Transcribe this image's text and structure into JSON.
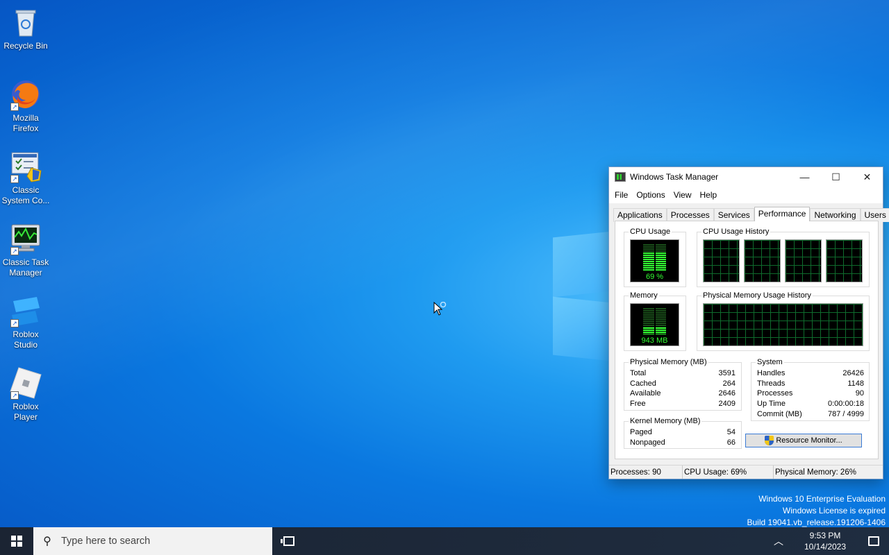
{
  "desktop": {
    "icons": [
      {
        "label": "Recycle Bin",
        "icon": "recycle-bin-icon"
      },
      {
        "label": "Mozilla Firefox",
        "icon": "firefox-icon"
      },
      {
        "label": "Classic System Co...",
        "icon": "classic-system-config-icon"
      },
      {
        "label": "Classic Task Manager",
        "icon": "task-manager-icon"
      },
      {
        "label": "Roblox Studio",
        "icon": "roblox-studio-icon"
      },
      {
        "label": "Roblox Player",
        "icon": "roblox-player-icon"
      }
    ],
    "watermark": {
      "line1": "Windows 10 Enterprise Evaluation",
      "line2": "Windows License is expired",
      "line3": "Build 19041.vb_release.191206-1406"
    }
  },
  "task_manager": {
    "title": "Windows Task Manager",
    "caption_buttons": {
      "minimize": "—",
      "maximize": "☐",
      "close": "✕"
    },
    "menu": [
      "File",
      "Options",
      "View",
      "Help"
    ],
    "tabs": [
      "Applications",
      "Processes",
      "Services",
      "Performance",
      "Networking",
      "Users"
    ],
    "active_tab": "Performance",
    "cpu_usage": {
      "label": "CPU Usage",
      "value": "69 %",
      "percent": 69
    },
    "cpu_history": {
      "label": "CPU Usage History",
      "cores": 4
    },
    "memory": {
      "label": "Memory",
      "value": "943 MB",
      "percent": 26
    },
    "memory_history": {
      "label": "Physical Memory Usage History"
    },
    "physical_memory": {
      "label": "Physical Memory (MB)",
      "rows": [
        {
          "name": "Total",
          "value": "3591"
        },
        {
          "name": "Cached",
          "value": "264"
        },
        {
          "name": "Available",
          "value": "2646"
        },
        {
          "name": "Free",
          "value": "2409"
        }
      ]
    },
    "kernel_memory": {
      "label": "Kernel Memory (MB)",
      "rows": [
        {
          "name": "Paged",
          "value": "54"
        },
        {
          "name": "Nonpaged",
          "value": "66"
        }
      ]
    },
    "system": {
      "label": "System",
      "rows": [
        {
          "name": "Handles",
          "value": "26426"
        },
        {
          "name": "Threads",
          "value": "1148"
        },
        {
          "name": "Processes",
          "value": "90"
        },
        {
          "name": "Up Time",
          "value": "0:00:00:18"
        },
        {
          "name": "Commit (MB)",
          "value": "787 / 4999"
        }
      ]
    },
    "resource_monitor_button": "Resource Monitor...",
    "status": {
      "processes": "Processes: 90",
      "cpu": "CPU Usage: 69%",
      "memory": "Physical Memory: 26%"
    }
  },
  "taskbar": {
    "search_placeholder": "Type here to search",
    "time": "9:53 PM",
    "date": "10/14/2023"
  }
}
